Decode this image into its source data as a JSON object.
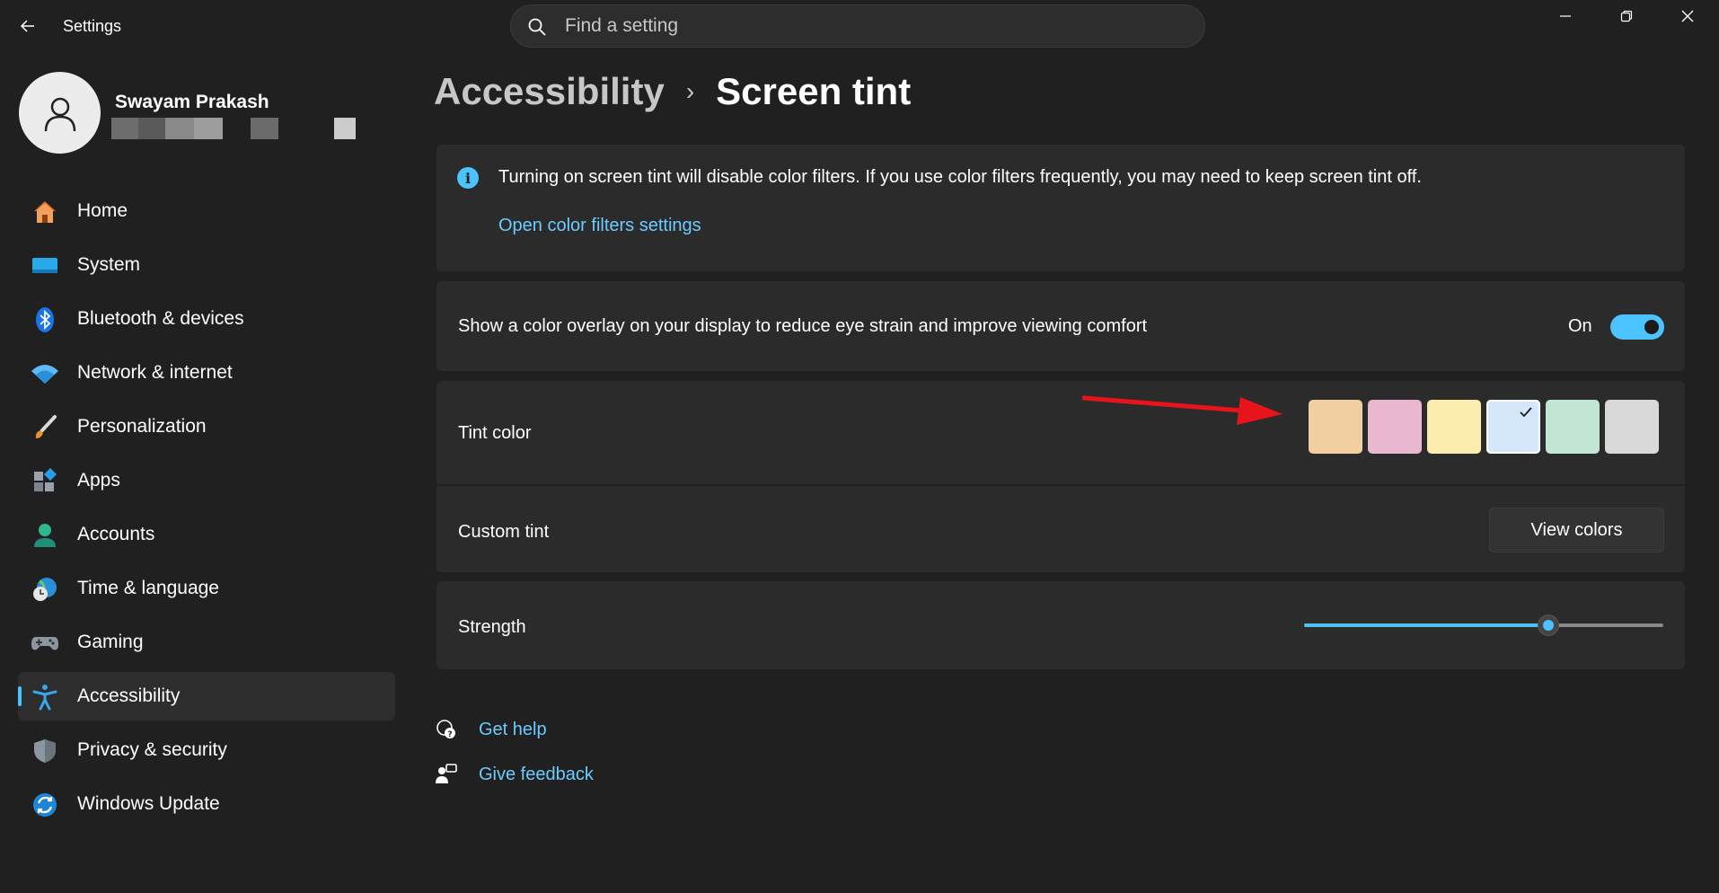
{
  "window": {
    "title": "Settings",
    "search_placeholder": "Find a setting"
  },
  "profile": {
    "name": "Swayam Prakash"
  },
  "sidebar": {
    "items": [
      {
        "label": "Home",
        "icon": "home-icon",
        "active": false
      },
      {
        "label": "System",
        "icon": "system-icon",
        "active": false
      },
      {
        "label": "Bluetooth & devices",
        "icon": "bluetooth-icon",
        "active": false
      },
      {
        "label": "Network & internet",
        "icon": "wifi-icon",
        "active": false
      },
      {
        "label": "Personalization",
        "icon": "brush-icon",
        "active": false
      },
      {
        "label": "Apps",
        "icon": "apps-icon",
        "active": false
      },
      {
        "label": "Accounts",
        "icon": "accounts-icon",
        "active": false
      },
      {
        "label": "Time & language",
        "icon": "time-language-icon",
        "active": false
      },
      {
        "label": "Gaming",
        "icon": "gamepad-icon",
        "active": false
      },
      {
        "label": "Accessibility",
        "icon": "accessibility-icon",
        "active": true
      },
      {
        "label": "Privacy & security",
        "icon": "shield-icon",
        "active": false
      },
      {
        "label": "Windows Update",
        "icon": "update-icon",
        "active": false
      }
    ]
  },
  "breadcrumb": {
    "parent": "Accessibility",
    "separator": "›",
    "current": "Screen tint"
  },
  "info": {
    "text": "Turning on screen tint will disable color filters. If you use color filters frequently, you may need to keep screen tint off.",
    "link": "Open color filters settings"
  },
  "overlay": {
    "label": "Show a color overlay on your display to reduce eye strain and improve viewing comfort",
    "state": "On",
    "enabled": true
  },
  "tint": {
    "label": "Tint color",
    "selected_index": 3,
    "swatches": [
      "#f2cfa0",
      "#e9b7cf",
      "#fcedaf",
      "#d4e7fb",
      "#c3e5d3",
      "#d9d9d9"
    ]
  },
  "custom_tint": {
    "label": "Custom tint",
    "button": "View colors"
  },
  "strength": {
    "label": "Strength",
    "value": 0.68
  },
  "help": {
    "get_help": "Get help",
    "feedback": "Give feedback"
  },
  "colors": {
    "accent": "#4cc2ff",
    "link": "#6ccbff",
    "annotation_arrow": "#e8141b"
  }
}
